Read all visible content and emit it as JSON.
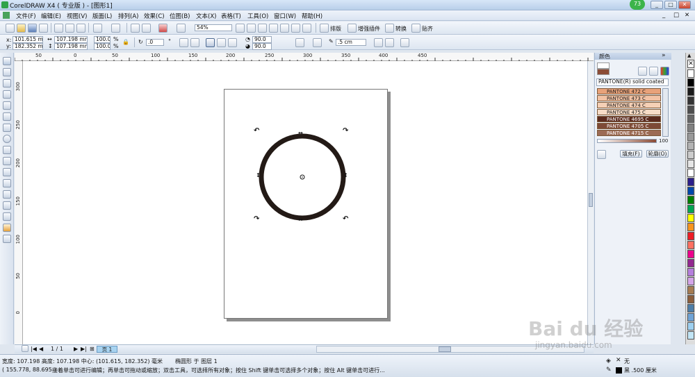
{
  "window": {
    "title": "CorelDRAW X4 ( 专业版 ) - [图形1]",
    "badge": "73",
    "controls": [
      "_",
      "□",
      "✕"
    ]
  },
  "menu": {
    "items": [
      "文件(F)",
      "编辑(E)",
      "视图(V)",
      "版面(L)",
      "排列(A)",
      "效果(C)",
      "位图(B)",
      "文本(X)",
      "表格(T)",
      "工具(O)",
      "窗口(W)",
      "帮助(H)"
    ],
    "doc_controls": [
      "_",
      "□",
      "✕"
    ]
  },
  "standard_toolbar": {
    "zoom_value": "54%",
    "buttons": [
      "排版",
      "增强插件",
      "转换",
      "贴齐"
    ]
  },
  "property_bar": {
    "x": "101.615 mm",
    "y": "182.352 mm",
    "w": "107.198 mm",
    "h": "107.198 mm",
    "x_label": "x:",
    "y_label": "y:",
    "scale_w": "100.0",
    "scale_h": "100.0",
    "percent": "%",
    "rotation": ".0",
    "degree": "°",
    "arc_start": "90.0",
    "arc_end": "90.0",
    "outline_width": ".5 cm"
  },
  "rulers": {
    "h_ticks": [
      "50",
      "0",
      "50",
      "100",
      "150",
      "200",
      "250",
      "300",
      "350",
      "400",
      "450"
    ],
    "v_ticks": [
      "300",
      "250",
      "200",
      "150",
      "100",
      "50",
      "0"
    ]
  },
  "docker": {
    "title": "颜色",
    "palette_name": "PANTONE(R) solid coated",
    "swatches": [
      {
        "name": "PANTONE 472 C",
        "color": "#e8a27a"
      },
      {
        "name": "PANTONE 473 C",
        "color": "#f2c2a4"
      },
      {
        "name": "PANTONE 474 C",
        "color": "#f5d0b6"
      },
      {
        "name": "PANTONE 475 C",
        "color": "#f6dcc7"
      },
      {
        "name": "PANTONE 4695 C",
        "color": "#5a2a1e"
      },
      {
        "name": "PANTONE 4705 C",
        "color": "#7d4a36"
      },
      {
        "name": "PANTONE 4715 C",
        "color": "#9c6b55"
      }
    ],
    "tint_value": "100",
    "fill_button": "填充(F)",
    "outline_button": "轮廓(O)"
  },
  "palette_colors": [
    "#ffffff",
    "#000000",
    "#1a1a1a",
    "#333333",
    "#4d4d4d",
    "#666666",
    "#808080",
    "#999999",
    "#b3b3b3",
    "#cccccc",
    "#e6e6e6",
    "#ffffff",
    "#2b1e8a",
    "#0047ab",
    "#008000",
    "#00a651",
    "#ffff00",
    "#f7941d",
    "#ed1c24",
    "#ff6f61",
    "#ec008c",
    "#92278f",
    "#b57edc",
    "#d4a5e8",
    "#a67c52",
    "#8b5e3c",
    "#4d7ea8",
    "#6fa3d6",
    "#9ed0f0",
    "#c2e5f5"
  ],
  "pagebar": {
    "page_counter": "1 / 1",
    "page_tab": "页 1"
  },
  "status": {
    "line1_dims": "宽度: 107.198  高度: 107.198  中心: (101.615, 182.352)  毫米",
    "line1_object": "椭圆形 于 图层 1",
    "line2_coords": "( 155.778, 88.695 )",
    "line2_hint": "接着单击可进行编辑；再单击可拖动或缩放；双击工具，可选择所有对象；按住 Shift 键单击可选择多个对象；按住 Alt 键单击可进行...",
    "fill_label": "无",
    "outline_label": "黑  .500 厘米"
  },
  "watermark": {
    "brand": "Bai du 经验",
    "url": "jingyan.baidu.com"
  }
}
